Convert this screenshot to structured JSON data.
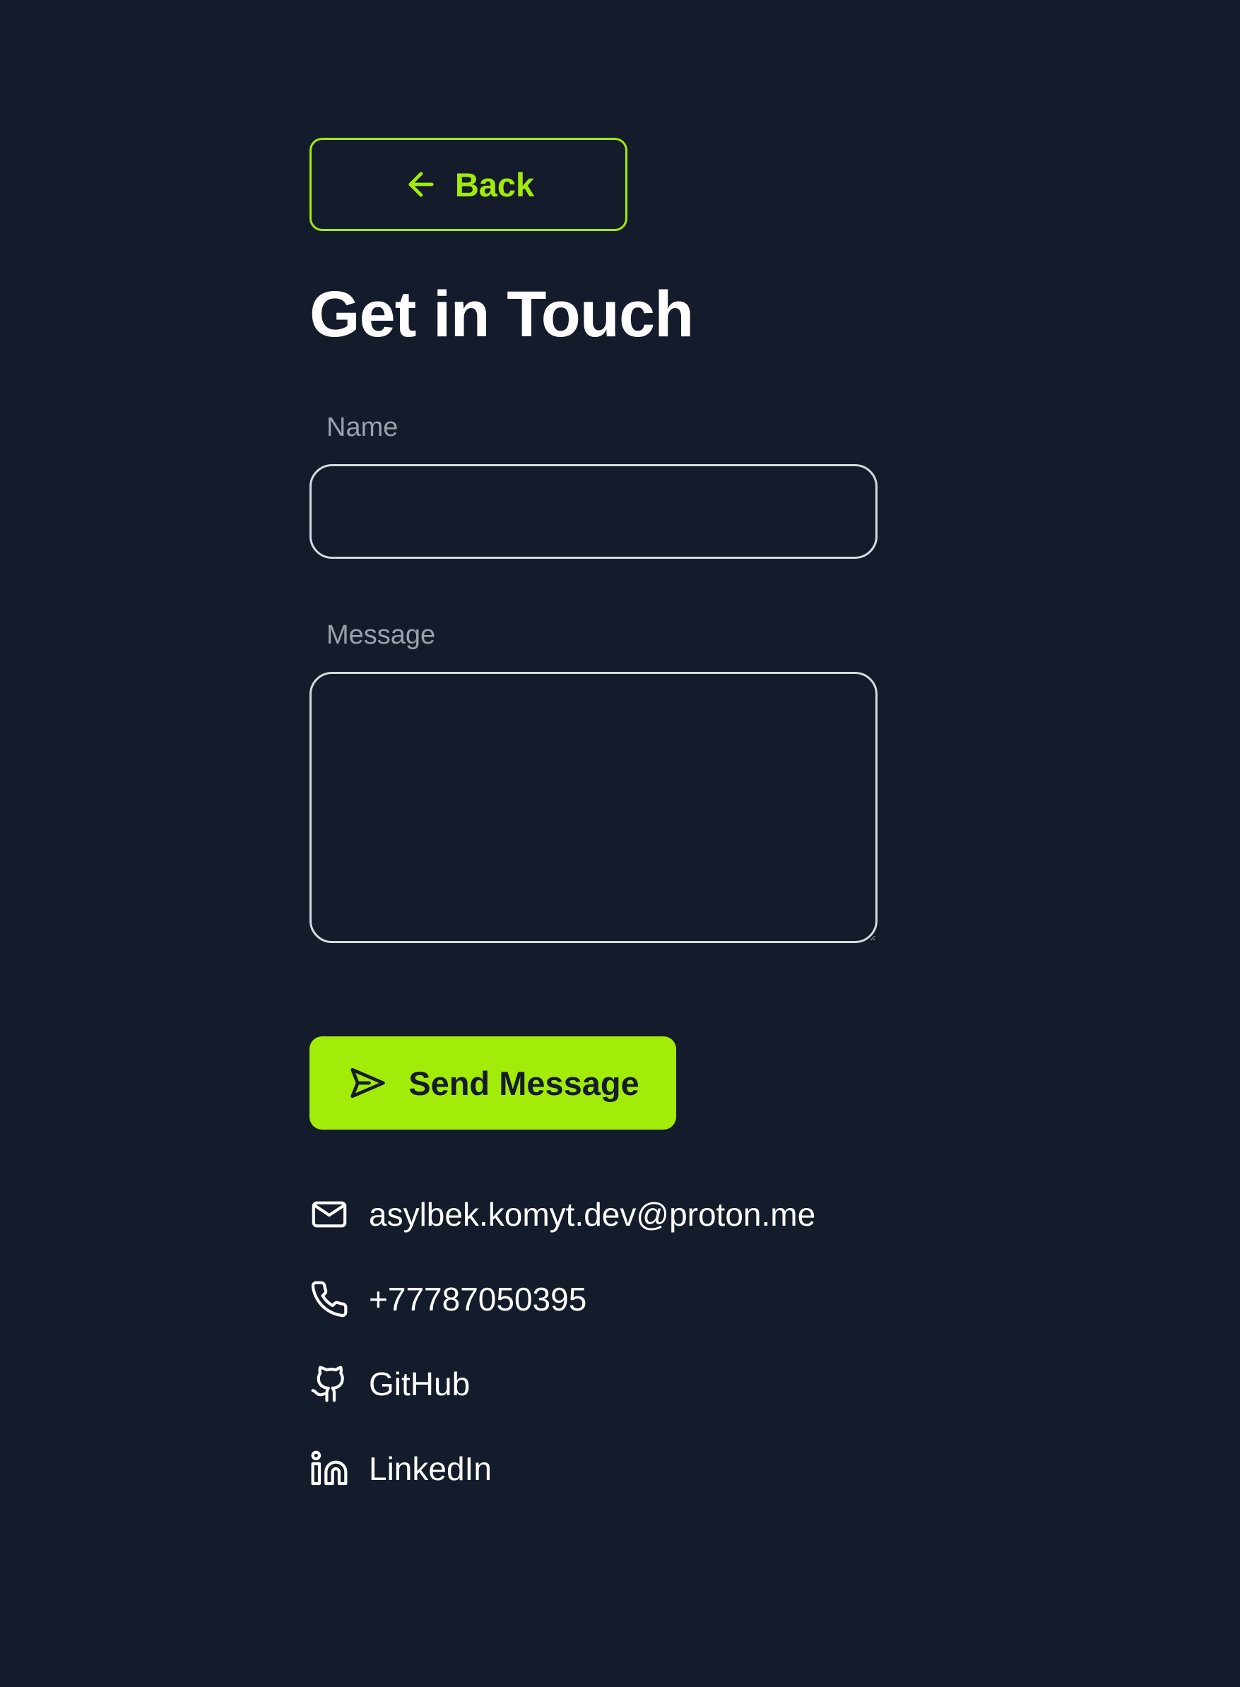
{
  "back": {
    "label": "Back"
  },
  "title": "Get in Touch",
  "form": {
    "name_label": "Name",
    "name_value": "",
    "message_label": "Message",
    "message_value": "",
    "submit_label": "Send Message"
  },
  "contacts": {
    "email": "asylbek.komyt.dev@proton.me",
    "phone": "+77787050395",
    "github": "GitHub",
    "linkedin": "LinkedIn"
  },
  "colors": {
    "background": "#141c2b",
    "accent": "#a3ec0a",
    "text": "#ffffff",
    "muted": "#9aa1ad",
    "border": "#d6dae0"
  },
  "icons": [
    "arrow-left-icon",
    "send-icon",
    "mail-icon",
    "phone-icon",
    "github-icon",
    "linkedin-icon"
  ]
}
